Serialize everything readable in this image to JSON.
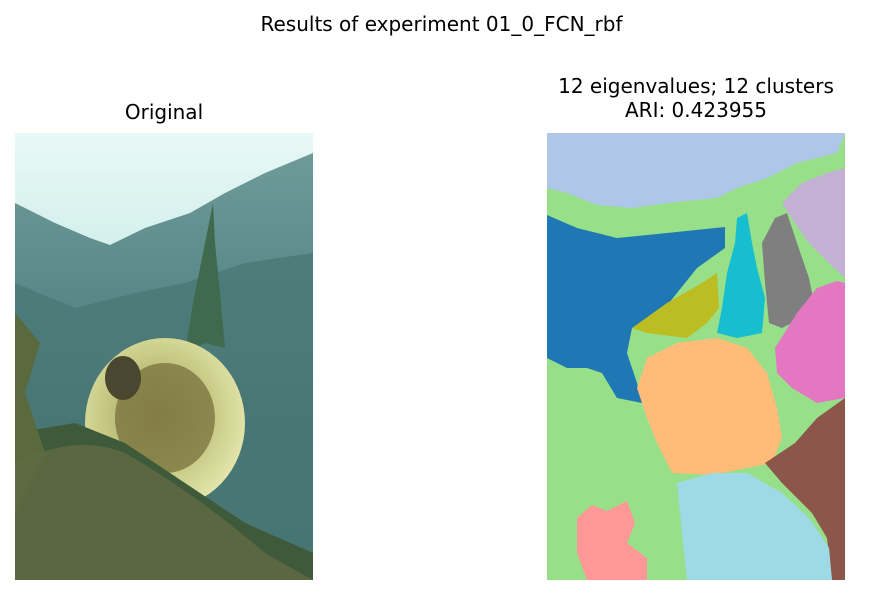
{
  "figure": {
    "suptitle": "Results of experiment 01_0_FCN_rbf"
  },
  "left_panel": {
    "title": "Original"
  },
  "right_panel": {
    "title_line1": "12 eigenvalues; 12 clusters",
    "title_line2": "ARI: 0.423955"
  },
  "segment_colors": {
    "background_green": "#98df8a",
    "sky_lightblue": "#aec7e8",
    "blue": "#1f77b4",
    "olive": "#bcbd22",
    "cyan": "#17becf",
    "gray": "#7f7f7f",
    "lavender": "#c5b0d5",
    "pink": "#e377c2",
    "orange": "#ffbb78",
    "brown": "#8c564b",
    "salmon": "#ff9896",
    "light_cyan": "#9edae5"
  }
}
